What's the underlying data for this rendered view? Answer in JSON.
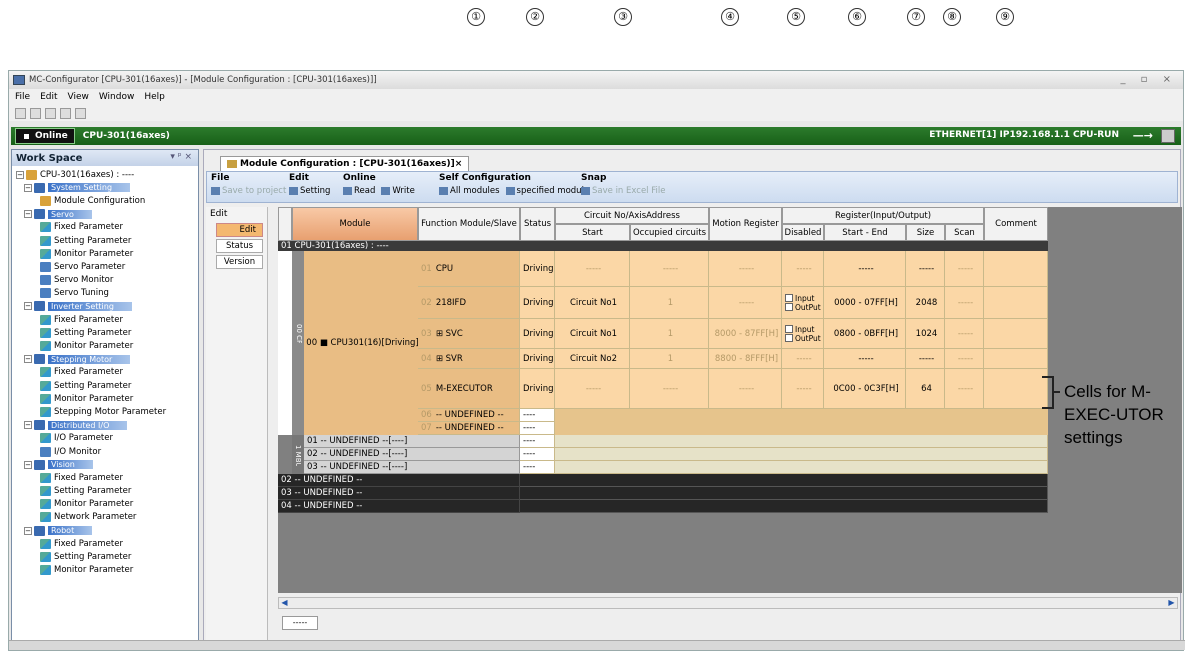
{
  "callouts": [
    "①",
    "②",
    "③",
    "④",
    "⑤",
    "⑥",
    "⑦",
    "⑧",
    "⑨"
  ],
  "window": {
    "title": "MC-Configurator [CPU-301(16axes)] - [Module Configuration : [CPU-301(16axes)]]",
    "menu": [
      "File",
      "Edit",
      "View",
      "Window",
      "Help"
    ]
  },
  "online": {
    "label": "Online",
    "cpu": "CPU-301(16axes)",
    "connection": "ETHERNET[1] IP192.168.1.1 CPU-RUN",
    "arrow": "—→"
  },
  "workspace": {
    "title": "Work Space",
    "pins": "▾ ᵖ ×",
    "tree": [
      {
        "label": "CPU-301(16axes) : ----",
        "kind": "root"
      },
      {
        "label": "System Setting",
        "kind": "cat"
      },
      {
        "label": "Module Configuration",
        "kind": "mod"
      },
      {
        "label": "Servo",
        "kind": "cat"
      },
      {
        "label": "Fixed Parameter",
        "kind": "param"
      },
      {
        "label": "Setting Parameter",
        "kind": "param"
      },
      {
        "label": "Monitor Parameter",
        "kind": "param"
      },
      {
        "label": "Servo Parameter",
        "kind": "mon"
      },
      {
        "label": "Servo Monitor",
        "kind": "mon"
      },
      {
        "label": "Servo Tuning",
        "kind": "mon"
      },
      {
        "label": "Inverter Setting",
        "kind": "cat"
      },
      {
        "label": "Fixed Parameter",
        "kind": "param"
      },
      {
        "label": "Setting Parameter",
        "kind": "param"
      },
      {
        "label": "Monitor Parameter",
        "kind": "param"
      },
      {
        "label": "Stepping Motor",
        "kind": "cat"
      },
      {
        "label": "Fixed Parameter",
        "kind": "param"
      },
      {
        "label": "Setting Parameter",
        "kind": "param"
      },
      {
        "label": "Monitor Parameter",
        "kind": "param"
      },
      {
        "label": "Stepping Motor Parameter",
        "kind": "param"
      },
      {
        "label": "Distributed I/O",
        "kind": "cat"
      },
      {
        "label": "I/O Parameter",
        "kind": "param"
      },
      {
        "label": "I/O Monitor",
        "kind": "mon"
      },
      {
        "label": "Vision",
        "kind": "cat"
      },
      {
        "label": "Fixed Parameter",
        "kind": "param"
      },
      {
        "label": "Setting Parameter",
        "kind": "param"
      },
      {
        "label": "Monitor Parameter",
        "kind": "param"
      },
      {
        "label": "Network Parameter",
        "kind": "param"
      },
      {
        "label": "Robot",
        "kind": "cat"
      },
      {
        "label": "Fixed Parameter",
        "kind": "param"
      },
      {
        "label": "Setting Parameter",
        "kind": "param"
      },
      {
        "label": "Monitor Parameter",
        "kind": "param"
      }
    ]
  },
  "doc_tab": "Module Configuration : [CPU-301(16axes)]×",
  "ribbon": {
    "file": {
      "title": "File",
      "buttons": [
        "Save to project"
      ]
    },
    "edit": {
      "title": "Edit",
      "buttons": [
        "Setting"
      ]
    },
    "online": {
      "title": "Online",
      "buttons": [
        "Read",
        "Write"
      ]
    },
    "self_config": {
      "title": "Self Configuration",
      "buttons": [
        "All modules",
        "specified module"
      ]
    },
    "snap": {
      "title": "Snap",
      "buttons": [
        "Save in Excel File"
      ]
    }
  },
  "left_panel": {
    "head": "Edit",
    "buttons": [
      "Edit",
      "Status",
      "Version"
    ]
  },
  "grid": {
    "headers": {
      "module": "Module",
      "function": "Function Module/Slave",
      "status": "Status",
      "circuit_group": "Circuit No/AxisAddress",
      "start": "Start",
      "occupied": "Occupied circuits",
      "motion_register": "Motion Register",
      "register_group": "Register(Input/Output)",
      "disabled": "Disabled",
      "start_end": "Start - End",
      "size": "Size",
      "scan": "Scan",
      "comment": "Comment"
    },
    "top_row": "01 CPU-301(16axes) : ----",
    "cpu_module_label": "00 ■ CPU301(16)[Driving]",
    "cpu_vertical": "00 CPU-301",
    "mbu_vertical": "1 MBU-301",
    "rows": [
      {
        "fn_no": "01",
        "fn": "CPU",
        "status": "Driving",
        "circuit": "-----",
        "occupied": "-----",
        "motion": "-----",
        "disabled": "-----",
        "range": "-----",
        "size": "-----",
        "scan": "-----"
      },
      {
        "fn_no": "02",
        "fn": "218IFD",
        "status": "Driving",
        "circuit": "Circuit No1",
        "occupied": "1",
        "motion": "-----",
        "disabled_in": "Input",
        "disabled_out": "OutPut",
        "range": "0000 - 07FF[H]",
        "size": "2048",
        "scan": "-----"
      },
      {
        "fn_no": "03",
        "fn": "⊞ SVC",
        "status": "Driving",
        "circuit": "Circuit No1",
        "occupied": "1",
        "motion": "8000 - 87FF[H]",
        "disabled_in": "Input",
        "disabled_out": "OutPut",
        "range": "0800 - 0BFF[H]",
        "size": "1024",
        "scan": "-----"
      },
      {
        "fn_no": "04",
        "fn": "⊞ SVR",
        "status": "Driving",
        "circuit": "Circuit No2",
        "occupied": "1",
        "motion": "8800 - 8FFF[H]",
        "disabled": "-----",
        "range": "-----",
        "size": "-----",
        "scan": "-----"
      },
      {
        "fn_no": "05",
        "fn": "M-EXECUTOR",
        "status": "Driving",
        "circuit": "-----",
        "occupied": "-----",
        "motion": "-----",
        "disabled": "-----",
        "range": "0C00 - 0C3F[H]",
        "size": "64",
        "scan": "-----"
      },
      {
        "fn_no": "06",
        "fn": "-- UNDEFINED --",
        "status": "----"
      },
      {
        "fn_no": "07",
        "fn": "-- UNDEFINED --",
        "status": "----"
      }
    ],
    "mbu_rows": [
      "01 -- UNDEFINED --[----]",
      "02 -- UNDEFINED --[----]",
      "03 -- UNDEFINED --[----]"
    ],
    "mbu_status": "----",
    "dark_rows": [
      "02 -- UNDEFINED --",
      "03 -- UNDEFINED --",
      "04 -- UNDEFINED --"
    ]
  },
  "bottom_tab": "-----",
  "annotation": "Cells for M-EXEC-UTOR settings",
  "colors": {
    "online_bar": "#1f6d1f",
    "module_header": "#e8a070",
    "row_bg": "#fbd7a6",
    "cell_fn": "#e9bd84",
    "dark_row": "#262626"
  }
}
